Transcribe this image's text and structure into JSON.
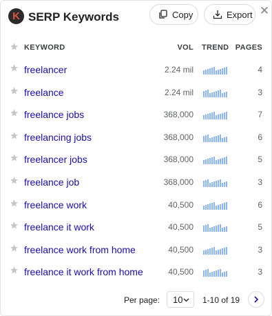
{
  "header": {
    "logo_letter": "K",
    "title": "SERP Keywords",
    "copy_label": "Copy",
    "export_label": "Export",
    "close_glyph": "✕"
  },
  "columns": {
    "keyword": "KEYWORD",
    "vol": "VOL",
    "trend": "TREND",
    "pages": "PAGES"
  },
  "rows": [
    {
      "keyword": "freelancer",
      "vol": "2.24 mil",
      "pages": "4"
    },
    {
      "keyword": "freelance",
      "vol": "2.24 mil",
      "pages": "3"
    },
    {
      "keyword": "freelance jobs",
      "vol": "368,000",
      "pages": "7"
    },
    {
      "keyword": "freelancing jobs",
      "vol": "368,000",
      "pages": "6"
    },
    {
      "keyword": "freelancer jobs",
      "vol": "368,000",
      "pages": "5"
    },
    {
      "keyword": "freelance job",
      "vol": "368,000",
      "pages": "3"
    },
    {
      "keyword": "freelance work",
      "vol": "40,500",
      "pages": "6"
    },
    {
      "keyword": "freelance it work",
      "vol": "40,500",
      "pages": "5"
    },
    {
      "keyword": "freelance work from home",
      "vol": "40,500",
      "pages": "3"
    },
    {
      "keyword": "freelance it work from home",
      "vol": "40,500",
      "pages": "3"
    }
  ],
  "footer": {
    "per_page_label": "Per page:",
    "per_page_value": "10",
    "range_text": "1-10 of 19"
  },
  "colors": {
    "keyword_link": "#1a0dab",
    "trend_bar": "#8ab4f8",
    "star": "#c7c7c7",
    "logo_bg": "#2b2b2b",
    "logo_letter": "#e0523f"
  },
  "icons": {
    "star": "star-icon",
    "copy": "copy-icon",
    "export": "export-icon",
    "close": "close-icon",
    "dropdown": "chevron-down-icon",
    "next": "chevron-right-icon"
  }
}
